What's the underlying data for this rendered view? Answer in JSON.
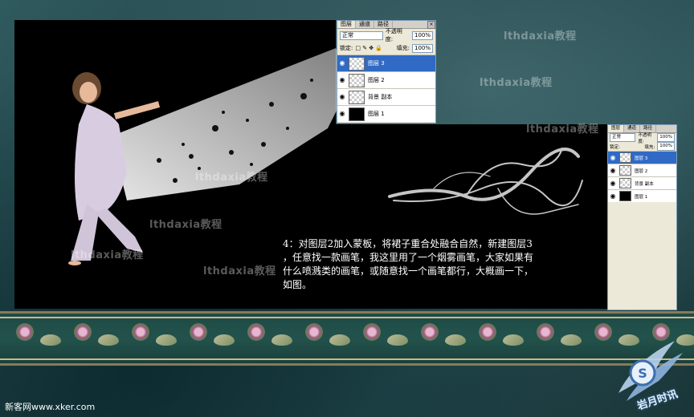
{
  "watermark": "lthdaxia教程",
  "instruction": "4：对图层2加入蒙板，将裙子重合处融合自然，新建图层3\n，任意找一款画笔，我这里用了一个烟雾画笔，大家如果有\n什么喷溅类的画笔，或随意找一个画笔都行，大概画一下，\n如图。",
  "layers_panel": {
    "tabs": [
      "图层",
      "通道",
      "路径"
    ],
    "blend_mode": "正常",
    "opacity_label": "不透明度:",
    "opacity_value": "100%",
    "lock_label": "锁定:",
    "fill_label": "填充:",
    "fill_value": "100%",
    "layers": [
      {
        "name": "图层 3",
        "thumb": "transparent",
        "active": true
      },
      {
        "name": "图层 2",
        "thumb": "transparent",
        "active": false
      },
      {
        "name": "背景 副本",
        "thumb": "transparent",
        "active": false
      },
      {
        "name": "图层 1",
        "thumb": "black",
        "active": false
      }
    ]
  },
  "footer": {
    "site": "新客网www.xker.com",
    "logo": "岩月时讯"
  }
}
